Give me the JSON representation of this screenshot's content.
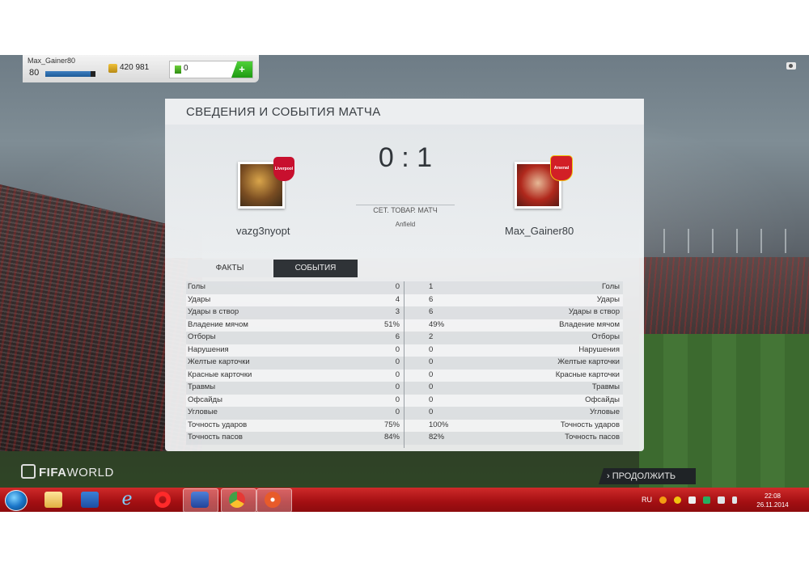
{
  "hud": {
    "username": "Max_Gainer80",
    "level": "80",
    "level_progress": 0.9,
    "coins": "420 981",
    "points": "0",
    "add_label": "+"
  },
  "panel": {
    "title": "СВЕДЕНИЯ И СОБЫТИЯ МАТЧА",
    "home_team": "vazg3nyopt",
    "away_team": "Max_Gainer80",
    "score": "0 : 1",
    "match_type": "СЕТ. ТОВАР. МАТЧ",
    "stadium": "Anfield",
    "home_crest": "Liverpool",
    "away_crest": "Arsenal",
    "tabs": [
      {
        "label": "ФАКТЫ",
        "active": true
      },
      {
        "label": "СОБЫТИЯ",
        "active": false
      }
    ]
  },
  "stats": [
    {
      "label": "Голы",
      "home": "0",
      "away": "1"
    },
    {
      "label": "Удары",
      "home": "4",
      "away": "6"
    },
    {
      "label": "Удары в створ",
      "home": "3",
      "away": "6"
    },
    {
      "label": "Владение мячом",
      "home": "51%",
      "away": "49%"
    },
    {
      "label": "Отборы",
      "home": "6",
      "away": "2"
    },
    {
      "label": "Нарушения",
      "home": "0",
      "away": "0"
    },
    {
      "label": "Желтые карточки",
      "home": "0",
      "away": "0"
    },
    {
      "label": "Красные карточки",
      "home": "0",
      "away": "0"
    },
    {
      "label": "Травмы",
      "home": "0",
      "away": "0"
    },
    {
      "label": "Офсайды",
      "home": "0",
      "away": "0"
    },
    {
      "label": "Угловые",
      "home": "0",
      "away": "0"
    },
    {
      "label": "Точность ударов",
      "home": "75%",
      "away": "100%"
    },
    {
      "label": "Точность пасов",
      "home": "84%",
      "away": "82%"
    }
  ],
  "brand": {
    "fifa": "FIFA",
    "world": "WORLD"
  },
  "continue_label": "› ПРОДОЛЖИТЬ",
  "taskbar": {
    "language": "RU",
    "time": "22:08",
    "date": "26.11.2014"
  }
}
